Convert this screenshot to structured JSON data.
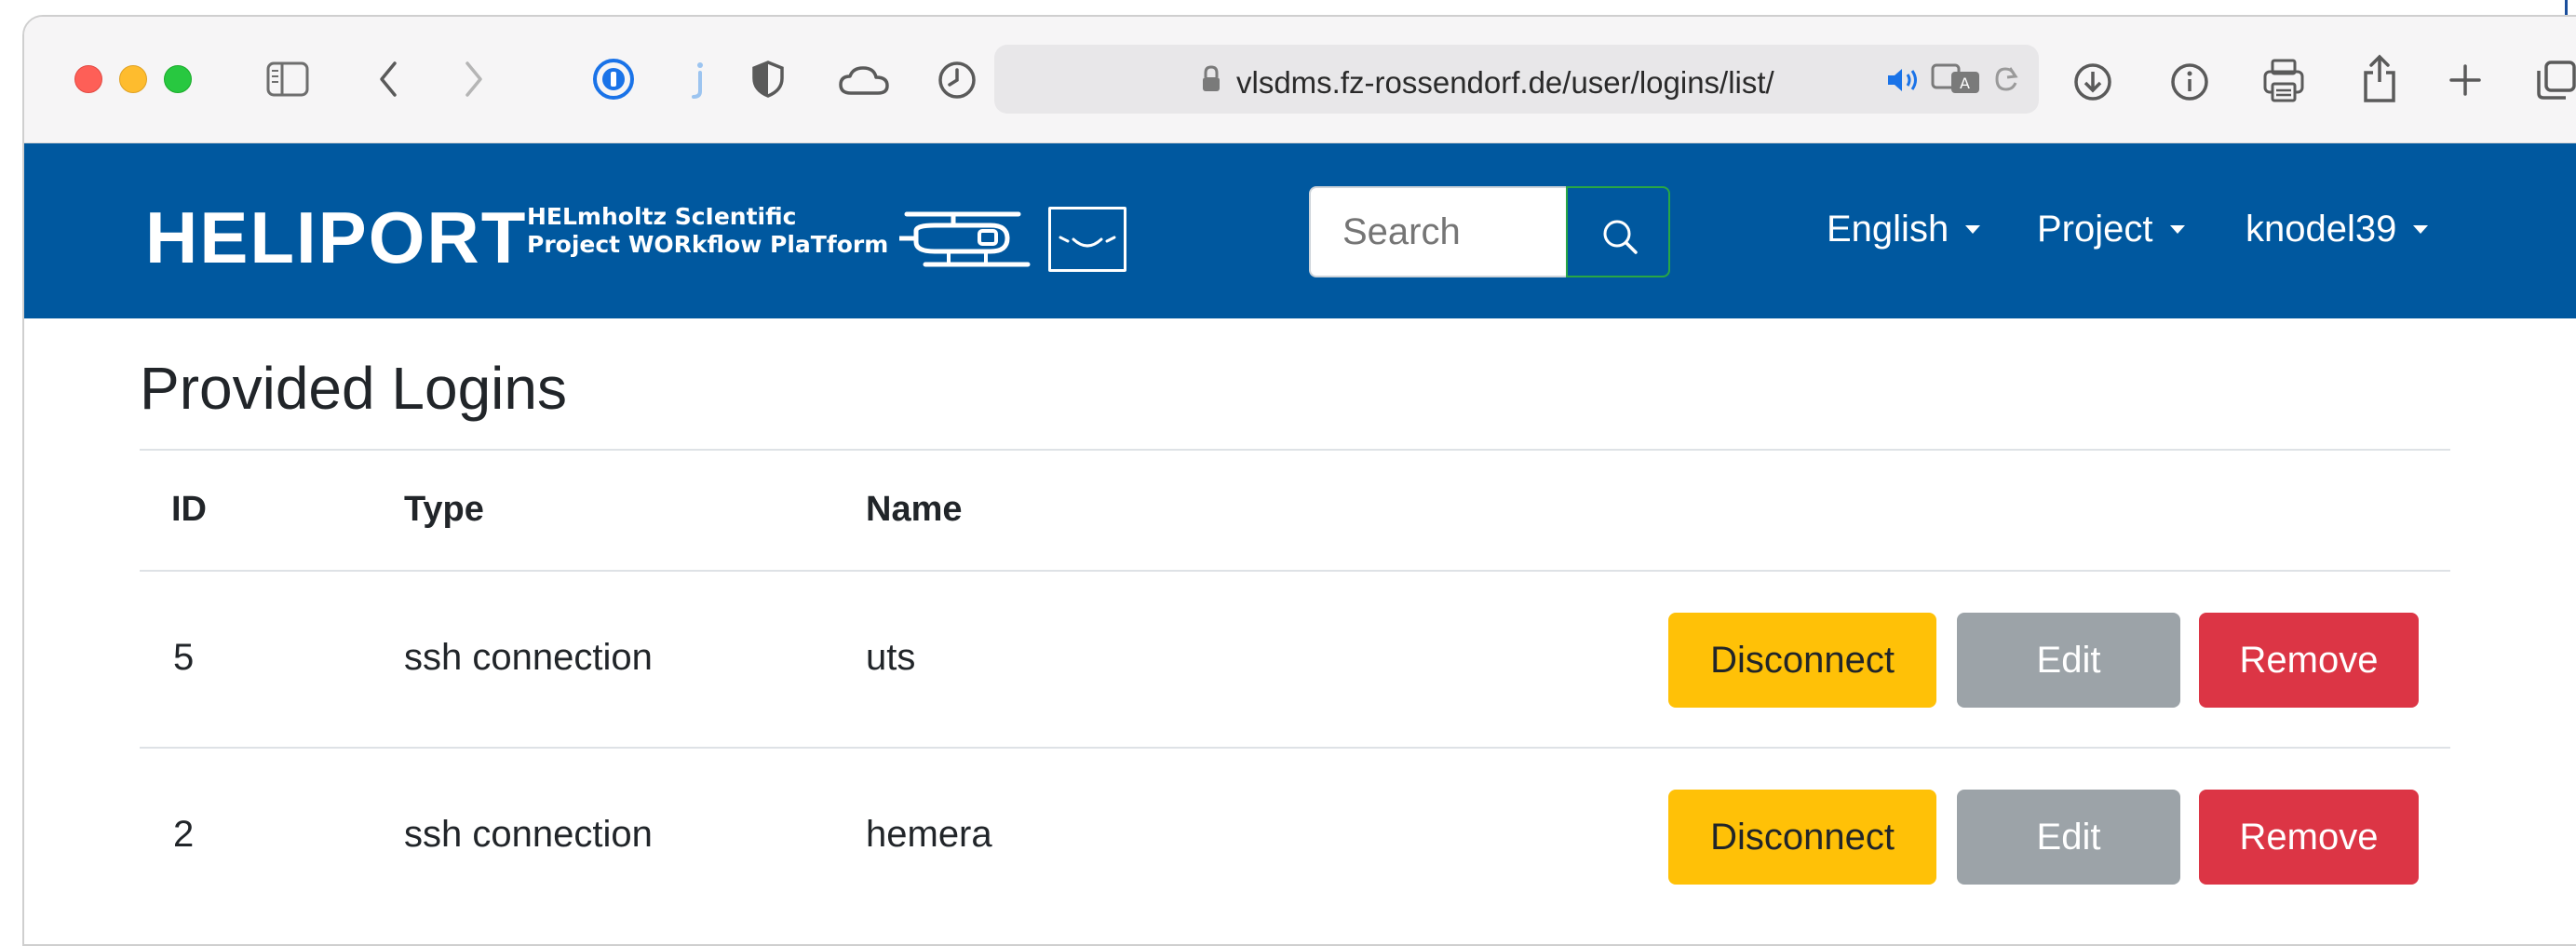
{
  "browser": {
    "url": "vlsdms.fz-rossendorf.de/user/logins/list/"
  },
  "navbar": {
    "brand": "HELIPORT",
    "tagline_line1": "HELmholtz ScIentific",
    "tagline_line2": "Project WORkflow PlaTform",
    "search_placeholder": "Search",
    "language": "English",
    "project": "Project",
    "user": "knodel39",
    "brand_color": "#00589f"
  },
  "page": {
    "title": "Provided Logins",
    "columns": [
      "ID",
      "Type",
      "Name"
    ],
    "rows": [
      {
        "id": "5",
        "type": "ssh connection",
        "name": "uts"
      },
      {
        "id": "2",
        "type": "ssh connection",
        "name": "hemera"
      }
    ],
    "actions": {
      "disconnect": "Disconnect",
      "edit": "Edit",
      "remove": "Remove"
    }
  }
}
